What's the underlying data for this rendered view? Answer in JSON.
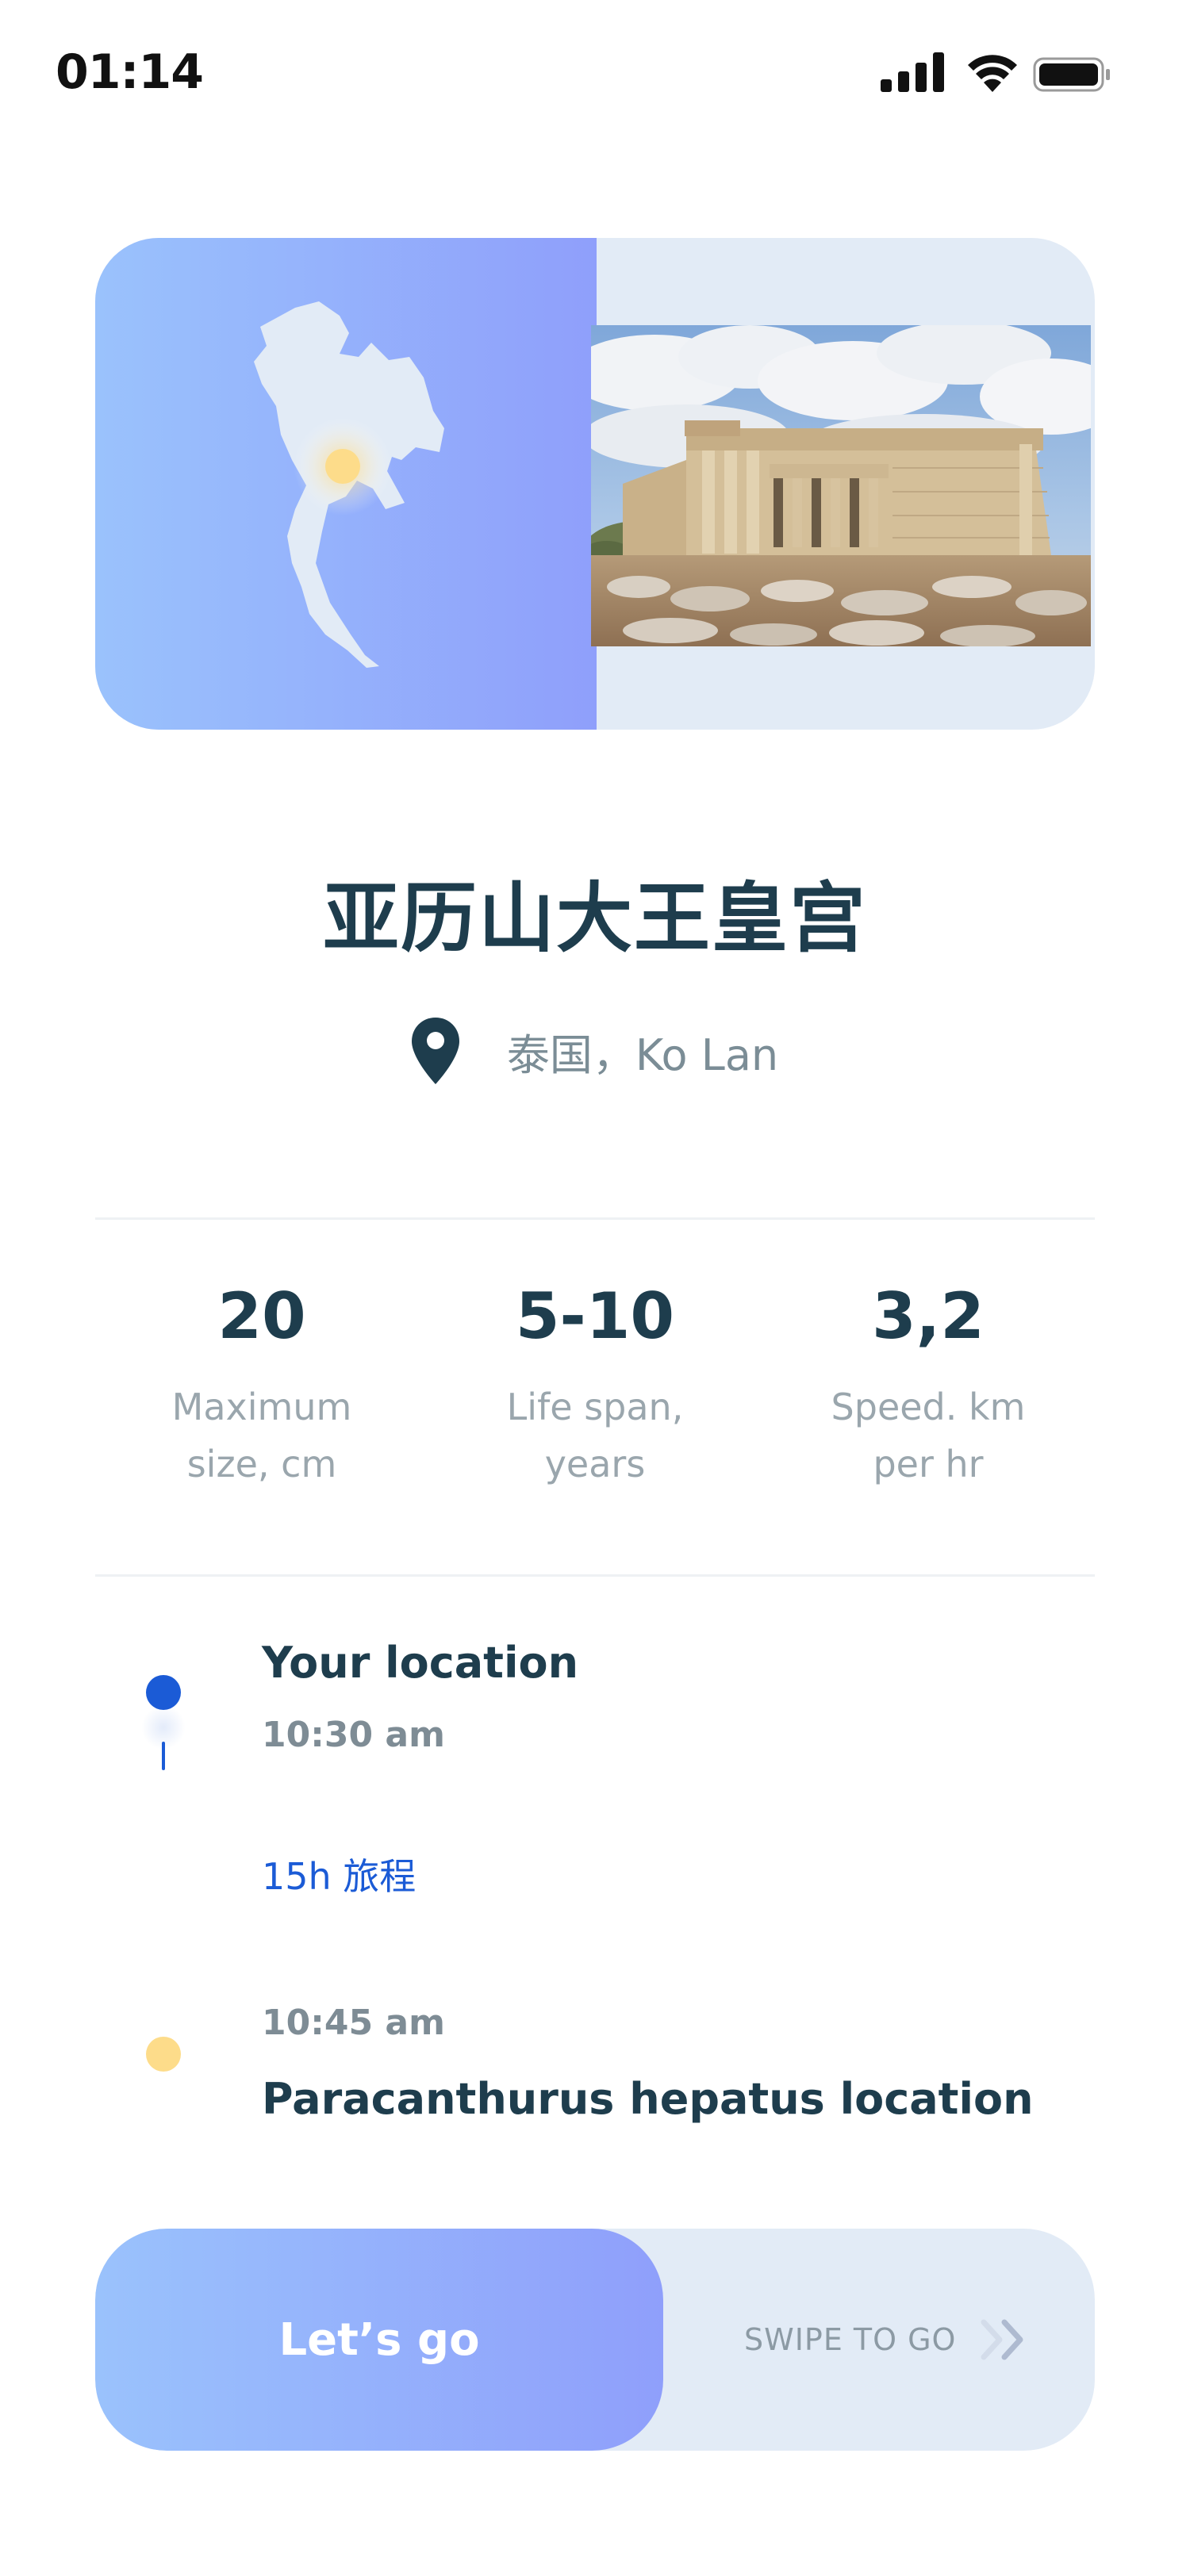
{
  "status_bar": {
    "time": "01:14"
  },
  "hero": {
    "map_alt": "thailand-map",
    "photo_alt": "temple-ruins-photo"
  },
  "place": {
    "title": "亚历山大王皇宫",
    "location": "泰国，Ko Lan"
  },
  "stats": [
    {
      "value": "20",
      "label_line1": "Maximum",
      "label_line2": "size, cm"
    },
    {
      "value": "5-10",
      "label_line1": "Life span,",
      "label_line2": "years"
    },
    {
      "value": "3,2",
      "label_line1": "Speed. km",
      "label_line2": "per hr"
    }
  ],
  "timeline": {
    "start": {
      "title": "Your location",
      "time": "10:30 am"
    },
    "duration": "15h 旅程",
    "end": {
      "time": "10:45 am",
      "title": "Paracanthurus hepatus location"
    }
  },
  "swipe": {
    "button_label": "Let’s go",
    "hint": "SWIPE TO GO"
  },
  "colors": {
    "accent_blue": "#1b5bd6",
    "gradient_start": "#9ac2fc",
    "gradient_end": "#8f9ffb",
    "pin_yellow": "#fddc8a",
    "title_dark": "#1e3d4d",
    "card_bg": "#e2ebf6"
  }
}
